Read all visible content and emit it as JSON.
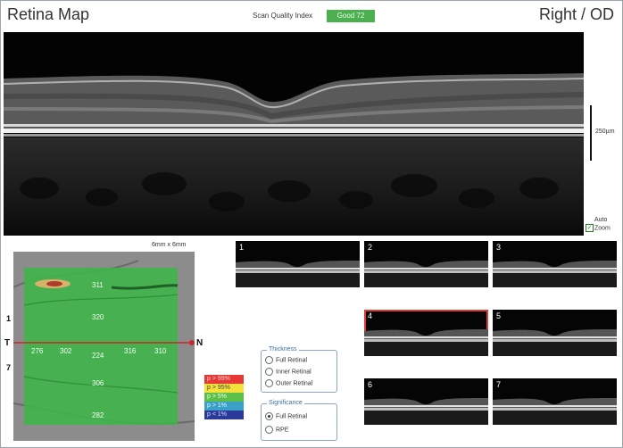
{
  "header": {
    "title": "Retina Map",
    "scan_quality_label": "Scan Quality Index",
    "scan_quality_value": "Good  72",
    "eye": "Right / OD"
  },
  "oct": {
    "scale_label": "250µm",
    "auto_zoom_line1": "Auto",
    "auto_zoom_line2": "Zoom"
  },
  "map": {
    "size_label": "6mm x 6mm",
    "axis": {
      "T": "T",
      "N": "N",
      "tick_top": "1",
      "tick_bottom": "7"
    },
    "values": {
      "superior_outer": "311",
      "superior_inner": "320",
      "temporal_outer": "276",
      "temporal_inner": "302",
      "center": "224",
      "nasal_inner": "316",
      "nasal_outer": "310",
      "inferior_inner": "306",
      "inferior_outer": "282"
    }
  },
  "legend": [
    {
      "label": "p > 99%",
      "color": "#e53935",
      "text": "#f9d0d0"
    },
    {
      "label": "p > 95%",
      "color": "#f4e23a",
      "text": "#444"
    },
    {
      "label": "p > 5%",
      "color": "#5cbf4a",
      "text": "#eaffea"
    },
    {
      "label": "p > 1%",
      "color": "#3aa0c8",
      "text": "#e0f5ff"
    },
    {
      "label": "p < 1%",
      "color": "#2b3a9a",
      "text": "#d8dcff"
    }
  ],
  "thickness": {
    "title": "Thickness",
    "options": [
      "Full Retinal",
      "Inner Retinal",
      "Outer Retinal"
    ]
  },
  "significance": {
    "title": "Significance",
    "options": [
      "Full Retinal",
      "RPE"
    ],
    "selected": "Full Retinal"
  },
  "thumbnails": [
    "1",
    "2",
    "3",
    "4",
    "5",
    "6",
    "7"
  ],
  "selected_thumbnail": "4"
}
